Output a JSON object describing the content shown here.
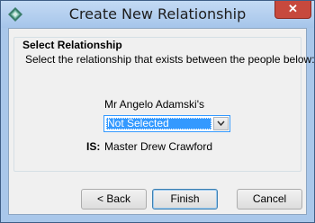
{
  "window": {
    "title": "Create New Relationship",
    "close_label": "✕",
    "app_icon": "diamond-app-icon",
    "colors": {
      "select_highlight": "#3399ff",
      "close_button": "#c7493d",
      "titlebar": "#a9c7ea"
    }
  },
  "group": {
    "title": "Select Relationship",
    "instruction": "Select the relationship that exists between the people below:",
    "person_one": "Mr Angelo Adamski's",
    "relationship_select": {
      "selected": "Not Selected"
    },
    "is_label": "IS:",
    "person_two": "Master Drew Crawford"
  },
  "buttons": {
    "back": "< Back",
    "finish": "Finish",
    "cancel": "Cancel"
  }
}
